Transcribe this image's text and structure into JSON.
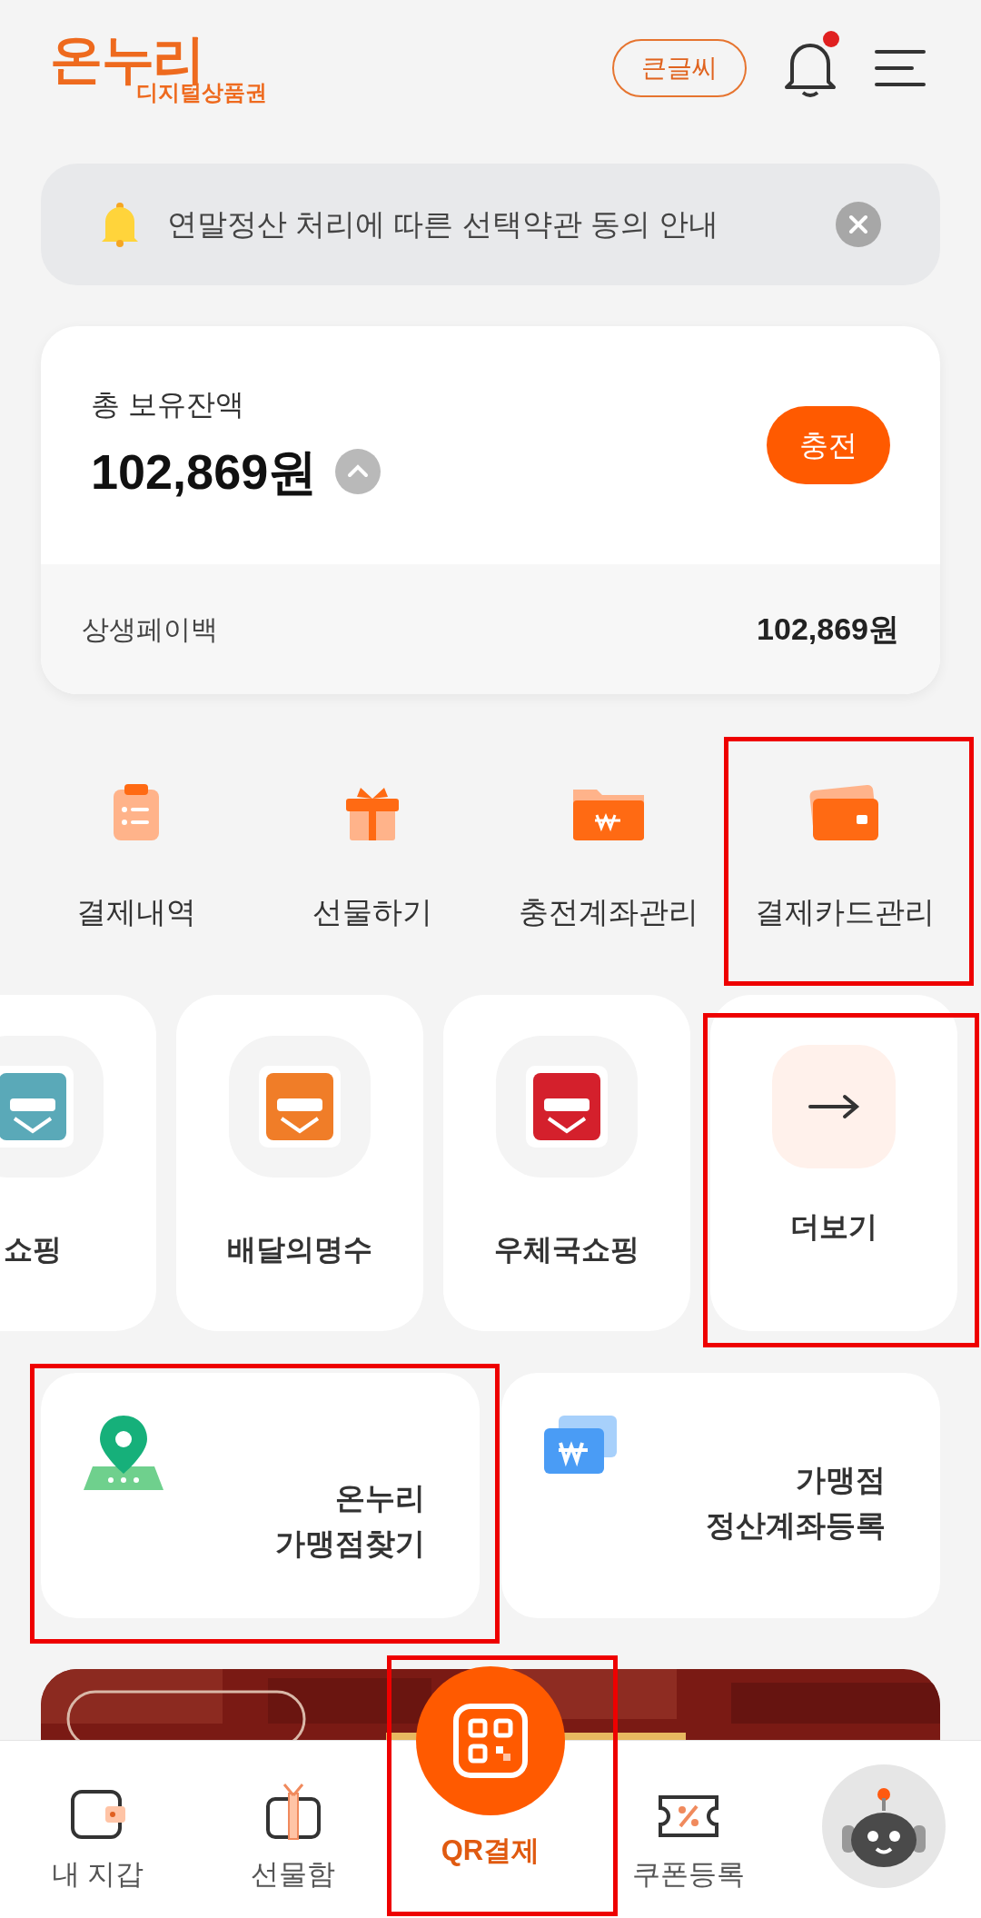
{
  "header": {
    "logo_main": "온누리",
    "logo_sub": "디지털상품권",
    "large_text_button": "큰글씨",
    "notification_unread": true
  },
  "notice": {
    "text": "연말정산 처리에 따른 선택약관 동의 안내"
  },
  "balance": {
    "label": "총 보유잔액",
    "amount": "102,869원",
    "expanded": true,
    "charge_button": "충전",
    "sub_label": "상생페이백",
    "sub_amount": "102,869원"
  },
  "quick_menu": [
    {
      "kind": "history",
      "label": "결제내역",
      "highlighted": false
    },
    {
      "kind": "gift",
      "label": "선물하기",
      "highlighted": false
    },
    {
      "kind": "account",
      "label": "충전계좌관리",
      "highlighted": false
    },
    {
      "kind": "card",
      "label": "결제카드관리",
      "highlighted": true
    }
  ],
  "shops": [
    {
      "kind": "app",
      "label": "쇼핑",
      "color": "#5aa9b8",
      "highlighted": false
    },
    {
      "kind": "app",
      "label": "배달의명수",
      "color": "#f07d28",
      "highlighted": false
    },
    {
      "kind": "app",
      "label": "우체국쇼핑",
      "color": "#d4202c",
      "highlighted": false
    },
    {
      "kind": "more",
      "label": "더보기",
      "highlighted": true
    }
  ],
  "store_cards": [
    {
      "kind": "map",
      "lines": [
        "온누리",
        "가맹점찾기"
      ],
      "highlighted": true
    },
    {
      "kind": "won",
      "lines": [
        "가맹점",
        "정산계좌등록"
      ],
      "highlighted": false
    }
  ],
  "bottom_nav": [
    {
      "kind": "wallet",
      "label": "내 지갑",
      "selected": false,
      "highlighted": false
    },
    {
      "kind": "gift",
      "label": "선물함",
      "selected": false,
      "highlighted": false
    },
    {
      "kind": "qr",
      "label": "QR결제",
      "selected": true,
      "highlighted": true
    },
    {
      "kind": "coupon",
      "label": "쿠폰등록",
      "selected": false,
      "highlighted": false
    },
    {
      "kind": "bot",
      "selected": false,
      "highlighted": false
    }
  ]
}
